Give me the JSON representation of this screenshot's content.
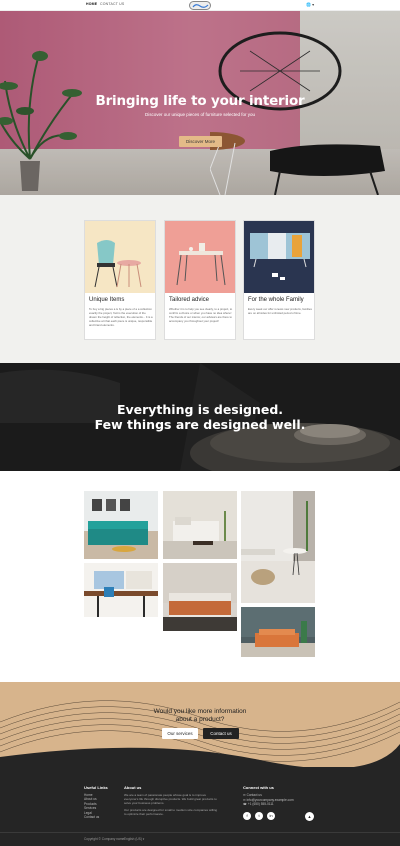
{
  "nav": {
    "home": "Home",
    "contact": "Contact us",
    "language": "🌐 ▾"
  },
  "hero": {
    "title": "Bringing life to your interior",
    "subtitle": "Discover our unique pieces of furniture selected for you",
    "button": "Discover More"
  },
  "cards": [
    {
      "title": "Unique Items",
      "text": "To buy a big pieces a is by a piece of a a collection exactly the project, fruit is the execution of the dream the height of reflection, the elements... It is a collective art that each piece is unique, responsible and brand elements."
    },
    {
      "title": "Tailored advice",
      "text": "Whether it is to help you see clearly, to a project, to confirm a choice or when you have no idea where! The friends of our interior, our advisors are there to accompany you throughout your project!"
    },
    {
      "title": "For the whole Family",
      "text": "Every week our offer renews new products, families are on all sides for unlimited period of time."
    }
  ],
  "banner": {
    "line1": "Everything is designed.",
    "line2": "Few things are designed well."
  },
  "cta": {
    "line1": "Would you like more information",
    "line2": "about a product?",
    "services_button": "Our services",
    "contact_button": "Contact us"
  },
  "footer": {
    "links_title": "Useful Links",
    "links": [
      "Home",
      "About us",
      "Products",
      "Services",
      "Legal",
      "Contact us"
    ],
    "about_title": "About us",
    "about_text1": "We are a team of passionate people whose goal is to improve everyone's life through disruptive products. We build great products to solve your business problems.",
    "about_text2": "Our products are designed for small to medium size companies willing to optimize their performance.",
    "connect_title": "Connect with us",
    "contact_items": [
      "Contact us",
      "info@yourcompany.example.com",
      "+1 (650) 555-0111"
    ],
    "social": [
      "f",
      "t",
      "in"
    ],
    "copyright": "Copyright © Company name",
    "language": "English (US) ▾"
  },
  "colors": {
    "accent": "#e4ba88",
    "cta_bg": "#d7b48c",
    "footer_bg": "#252525",
    "section_bg": "#f1f1ee"
  }
}
